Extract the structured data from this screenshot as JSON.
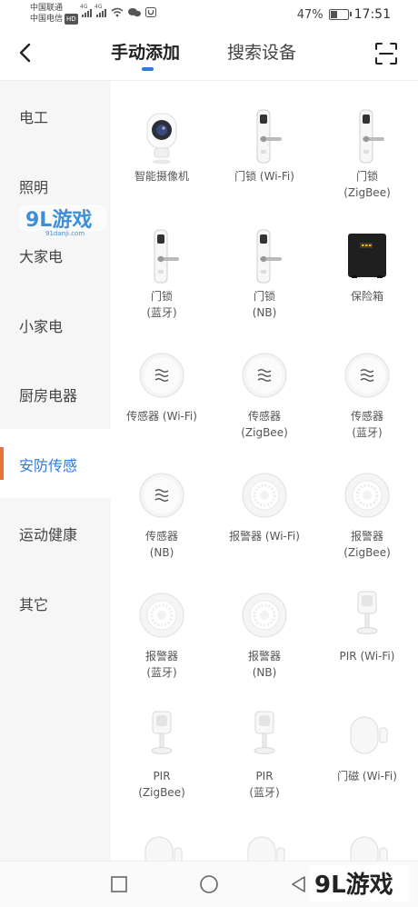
{
  "status": {
    "carrier1": "中国联通",
    "carrier2": "中国电信",
    "hd": "HD",
    "net1": "4G",
    "net2": "4G",
    "battery_text": "47%",
    "battery_level": 0.47,
    "time": "17:51"
  },
  "nav": {
    "tab_manual": "手动添加",
    "tab_search": "搜索设备",
    "active_tab": "手动添加",
    "accent": "#2f7bd8"
  },
  "sidebar": {
    "items": [
      {
        "label": "电工"
      },
      {
        "label": "照明"
      },
      {
        "label": "大家电"
      },
      {
        "label": "小家电"
      },
      {
        "label": "厨房电器"
      },
      {
        "label": "安防传感"
      },
      {
        "label": "运动健康"
      },
      {
        "label": "其它"
      }
    ],
    "active": "安防传感",
    "active_indicator_color": "#e8733a"
  },
  "devices": [
    {
      "name": "智能摄像机",
      "icon": "camera-icon"
    },
    {
      "name": "门锁 (Wi-Fi)",
      "icon": "door-lock-icon"
    },
    {
      "name": "门锁\n(ZigBee)",
      "icon": "door-lock-icon"
    },
    {
      "name": "门锁\n(蓝牙)",
      "icon": "door-lock-icon"
    },
    {
      "name": "门锁\n(NB)",
      "icon": "door-lock-icon"
    },
    {
      "name": "保险箱",
      "icon": "safe-box-icon"
    },
    {
      "name": "传感器 (Wi-Fi)",
      "icon": "round-sensor-icon"
    },
    {
      "name": "传感器\n(ZigBee)",
      "icon": "round-sensor-icon"
    },
    {
      "name": "传感器\n(蓝牙)",
      "icon": "round-sensor-icon"
    },
    {
      "name": "传感器\n(NB)",
      "icon": "round-sensor-icon"
    },
    {
      "name": "报警器 (Wi-Fi)",
      "icon": "smoke-alarm-icon"
    },
    {
      "name": "报警器\n(ZigBee)",
      "icon": "smoke-alarm-icon"
    },
    {
      "name": "报警器\n(蓝牙)",
      "icon": "smoke-alarm-icon"
    },
    {
      "name": "报警器\n(NB)",
      "icon": "smoke-alarm-icon"
    },
    {
      "name": "PIR (Wi-Fi)",
      "icon": "pir-sensor-icon"
    },
    {
      "name": "PIR\n(ZigBee)",
      "icon": "pir-sensor-icon"
    },
    {
      "name": "PIR\n(蓝牙)",
      "icon": "pir-sensor-icon"
    },
    {
      "name": "门磁 (Wi-Fi)",
      "icon": "door-sensor-icon"
    },
    {
      "name": "",
      "icon": "door-sensor-icon"
    },
    {
      "name": "",
      "icon": "door-sensor-icon"
    },
    {
      "name": "",
      "icon": "door-sensor-icon"
    }
  ],
  "watermark": {
    "logo_text": "9L游戏",
    "site": "91danji.com"
  }
}
